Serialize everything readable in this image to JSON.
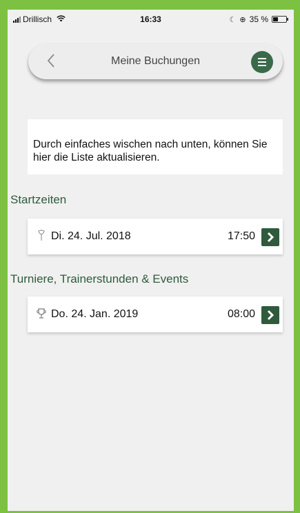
{
  "status_bar": {
    "carrier": "Drillisch",
    "time": "16:33",
    "battery_text": "35 %"
  },
  "header": {
    "title": "Meine Buchungen",
    "back_icon": "chevron-left-icon",
    "menu_icon": "hamburger-menu-icon"
  },
  "info": {
    "text": "Durch einfaches wischen nach unten, können Sie hier die Liste aktualisieren."
  },
  "sections": [
    {
      "title": "Startzeiten",
      "items": [
        {
          "icon": "golf-tee-icon",
          "date": "Di. 24. Jul. 2018",
          "time": "17:50"
        }
      ]
    },
    {
      "title": "Turniere, Trainerstunden & Events",
      "items": [
        {
          "icon": "trophy-icon",
          "date": "Do. 24. Jan. 2019",
          "time": "08:00"
        }
      ]
    }
  ],
  "colors": {
    "border_green": "#7dc142",
    "accent_dark_green": "#2f5a3c",
    "section_title_green": "#2e5a3c",
    "background": "#f0f0f0"
  }
}
